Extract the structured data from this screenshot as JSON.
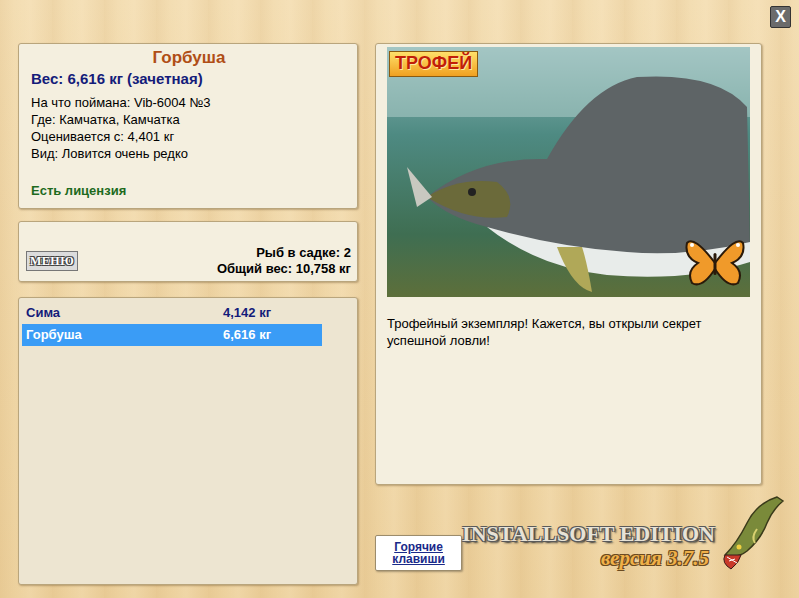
{
  "window": {
    "close": "X"
  },
  "fish_info": {
    "name": "Горбуша",
    "weight": "Вес: 6,616 кг (зачетная)",
    "details": [
      "На что поймана: Vib-6004 №3",
      "Где: Камчатка, Камчатка",
      "Оценивается с: 4,401 кг",
      "Вид: Ловится очень редко"
    ],
    "license": "Есть лицензия"
  },
  "keepnet": {
    "menu_button": "МЕНЮ",
    "count": "Рыб в садке: 2",
    "total": "Общий вес: 10,758 кг"
  },
  "catch_list": [
    {
      "name": "Сима",
      "weight": "4,142 кг",
      "selected": false
    },
    {
      "name": "Горбуша",
      "weight": "6,616 кг",
      "selected": true
    }
  ],
  "photo": {
    "badge": "ТРОФЕЙ"
  },
  "message": "Трофейный экземпляр! Кажется, вы открыли секрет успешной ловли!",
  "hotkeys_button": "Горячие клавиши",
  "logo": {
    "title": "INSTALLSOFT EDITION",
    "version": "версия 3.7.5"
  }
}
